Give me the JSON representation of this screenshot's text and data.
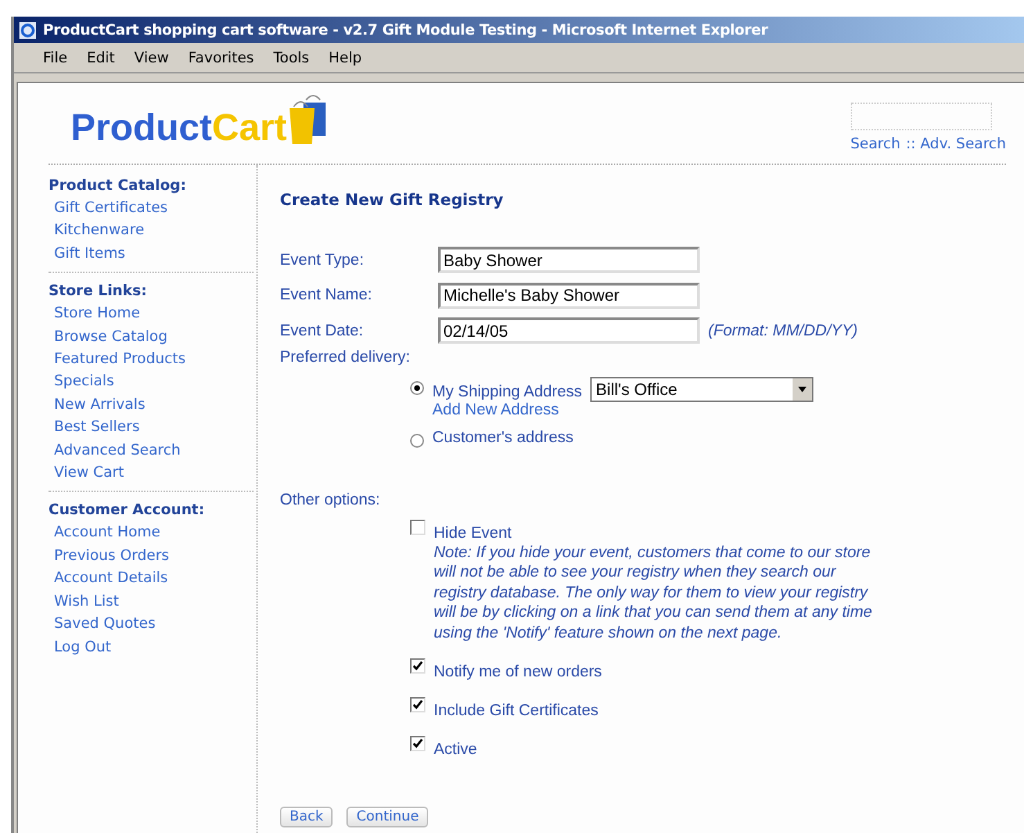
{
  "window": {
    "title": "ProductCart shopping cart software - v2.7 Gift Module Testing - Microsoft Internet Explorer"
  },
  "menu": [
    "File",
    "Edit",
    "View",
    "Favorites",
    "Tools",
    "Help"
  ],
  "logo": {
    "part_1": "Product",
    "part_2": "Cart"
  },
  "search": {
    "links": [
      "Search",
      ":: Adv. Search"
    ]
  },
  "sidebar": [
    {
      "heading": "Product Catalog:",
      "items": [
        "Gift Certificates",
        "Kitchenware",
        "Gift Items"
      ]
    },
    {
      "heading": "Store Links:",
      "items": [
        "Store Home",
        "Browse Catalog",
        "Featured Products",
        "Specials",
        "New Arrivals",
        "Best Sellers",
        "Advanced Search",
        "View Cart"
      ]
    },
    {
      "heading": "Customer Account:",
      "items": [
        "Account Home",
        "Previous Orders",
        "Account Details",
        "Wish List",
        "Saved Quotes",
        "Log Out"
      ]
    }
  ],
  "form": {
    "title": "Create New Gift Registry",
    "fields": [
      {
        "label": "Event Type:",
        "value": "Baby Shower"
      },
      {
        "label": "Event Name:",
        "value": "Michelle's Baby Shower"
      },
      {
        "label": "Event Date:",
        "value": "02/14/05",
        "hint": "(Format: MM/DD/YY)"
      }
    ],
    "delivery_label": "Preferred delivery:",
    "delivery": [
      {
        "label": "My Shipping Address",
        "selected": true,
        "select_value": "Bill's Office",
        "link": "Add New Address"
      },
      {
        "label": "Customer's address",
        "selected": false
      }
    ],
    "options_label": "Other options:",
    "options": [
      {
        "label": "Hide Event",
        "checked": false,
        "note": "Note: If you hide your event, customers that come to our store will not be able to see your registry when they search our registry database. The only way for them to view your registry will be by clicking on a link that you can send them at any time using the 'Notify' feature shown on the next page."
      },
      {
        "label": "Notify me of new orders",
        "checked": true
      },
      {
        "label": "Include Gift Certificates",
        "checked": true
      },
      {
        "label": "Active",
        "checked": true
      }
    ],
    "buttons": [
      "Back",
      "Continue"
    ]
  }
}
